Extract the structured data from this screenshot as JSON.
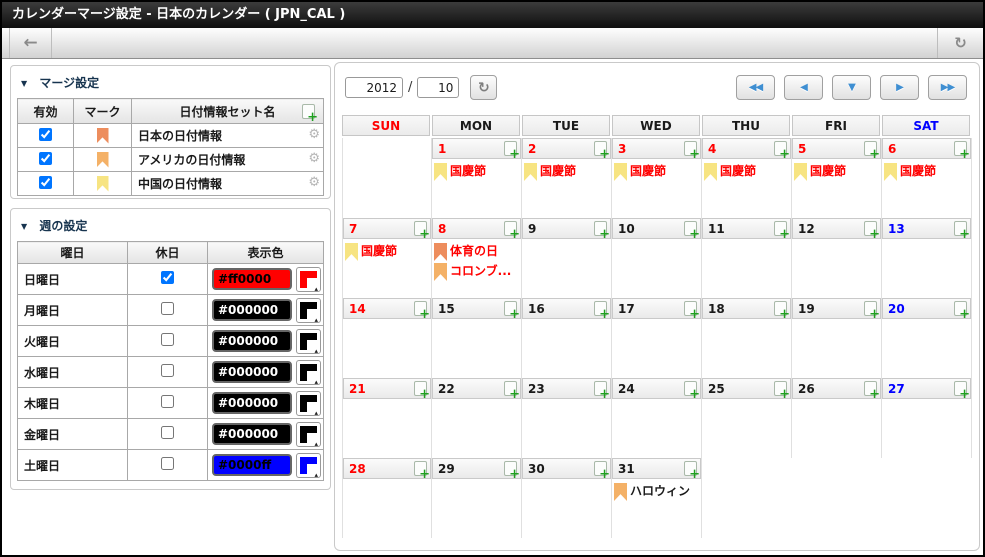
{
  "title_bar": {
    "title": "カレンダーマージ設定 - 日本のカレンダー ( JPN_CAL )"
  },
  "icons": {
    "back": "←",
    "refresh": "↻",
    "collapse": "▼",
    "plus": "+",
    "gear": "⚙",
    "nav_first": "◀◀",
    "nav_prev": "◀",
    "nav_today": "▼",
    "nav_next": "▶",
    "nav_last": "▶▶",
    "swatch_arrow": "▴"
  },
  "merge_panel": {
    "header": "マージ設定",
    "columns": {
      "enabled": "有効",
      "mark": "マーク",
      "name": "日付情報セット名"
    },
    "rows": [
      {
        "enabled": true,
        "mark_color": "#ed8d5d",
        "name": "日本の日付情報"
      },
      {
        "enabled": true,
        "mark_color": "#f4b167",
        "name": "アメリカの日付情報"
      },
      {
        "enabled": true,
        "mark_color": "#f7e482",
        "name": "中国の日付情報"
      }
    ]
  },
  "week_panel": {
    "header": "週の設定",
    "columns": {
      "day": "曜日",
      "holiday": "休日",
      "color": "表示色"
    },
    "rows": [
      {
        "day": "日曜日",
        "holiday": true,
        "color": "#ff0000",
        "text_color": "#000000"
      },
      {
        "day": "月曜日",
        "holiday": false,
        "color": "#000000",
        "text_color": "#ffffff"
      },
      {
        "day": "火曜日",
        "holiday": false,
        "color": "#000000",
        "text_color": "#ffffff"
      },
      {
        "day": "水曜日",
        "holiday": false,
        "color": "#000000",
        "text_color": "#ffffff"
      },
      {
        "day": "木曜日",
        "holiday": false,
        "color": "#000000",
        "text_color": "#ffffff"
      },
      {
        "day": "金曜日",
        "holiday": false,
        "color": "#000000",
        "text_color": "#ffffff"
      },
      {
        "day": "土曜日",
        "holiday": false,
        "color": "#0000ff",
        "text_color": "#000000"
      }
    ]
  },
  "calendar": {
    "year": "2012",
    "separator": "/",
    "month": "10",
    "day_headers": [
      {
        "label": "SUN",
        "color": "#ff0000"
      },
      {
        "label": "MON",
        "color": "#1a1a1a"
      },
      {
        "label": "TUE",
        "color": "#1a1a1a"
      },
      {
        "label": "WED",
        "color": "#1a1a1a"
      },
      {
        "label": "THU",
        "color": "#1a1a1a"
      },
      {
        "label": "FRI",
        "color": "#1a1a1a"
      },
      {
        "label": "SAT",
        "color": "#0000ff"
      }
    ],
    "mark_colors": {
      "japan": "#ed8d5d",
      "america": "#f4b167",
      "china": "#f7e482"
    },
    "weeks": [
      [
        {
          "date": null,
          "bordered": true
        },
        {
          "date": "1",
          "color": "#ff0000",
          "events": [
            {
              "set": "china",
              "label": "国慶節",
              "color": "#ff0000"
            }
          ]
        },
        {
          "date": "2",
          "color": "#ff0000",
          "events": [
            {
              "set": "china",
              "label": "国慶節",
              "color": "#ff0000"
            }
          ]
        },
        {
          "date": "3",
          "color": "#ff0000",
          "events": [
            {
              "set": "china",
              "label": "国慶節",
              "color": "#ff0000"
            }
          ]
        },
        {
          "date": "4",
          "color": "#ff0000",
          "events": [
            {
              "set": "china",
              "label": "国慶節",
              "color": "#ff0000"
            }
          ]
        },
        {
          "date": "5",
          "color": "#ff0000",
          "events": [
            {
              "set": "china",
              "label": "国慶節",
              "color": "#ff0000"
            }
          ]
        },
        {
          "date": "6",
          "color": "#ff0000",
          "events": [
            {
              "set": "china",
              "label": "国慶節",
              "color": "#ff0000"
            }
          ]
        }
      ],
      [
        {
          "date": "7",
          "color": "#ff0000",
          "events": [
            {
              "set": "china",
              "label": "国慶節",
              "color": "#ff0000"
            }
          ]
        },
        {
          "date": "8",
          "color": "#ff0000",
          "events": [
            {
              "set": "japan",
              "label": "体育の日",
              "color": "#ff0000"
            },
            {
              "set": "america",
              "label": "コロンブ...",
              "color": "#ff0000"
            }
          ]
        },
        {
          "date": "9",
          "color": "#1a1a1a"
        },
        {
          "date": "10",
          "color": "#1a1a1a"
        },
        {
          "date": "11",
          "color": "#1a1a1a"
        },
        {
          "date": "12",
          "color": "#1a1a1a"
        },
        {
          "date": "13",
          "color": "#0000ff"
        }
      ],
      [
        {
          "date": "14",
          "color": "#ff0000"
        },
        {
          "date": "15",
          "color": "#1a1a1a"
        },
        {
          "date": "16",
          "color": "#1a1a1a"
        },
        {
          "date": "17",
          "color": "#1a1a1a"
        },
        {
          "date": "18",
          "color": "#1a1a1a"
        },
        {
          "date": "19",
          "color": "#1a1a1a"
        },
        {
          "date": "20",
          "color": "#0000ff"
        }
      ],
      [
        {
          "date": "21",
          "color": "#ff0000"
        },
        {
          "date": "22",
          "color": "#1a1a1a"
        },
        {
          "date": "23",
          "color": "#1a1a1a"
        },
        {
          "date": "24",
          "color": "#1a1a1a"
        },
        {
          "date": "25",
          "color": "#1a1a1a"
        },
        {
          "date": "26",
          "color": "#1a1a1a"
        },
        {
          "date": "27",
          "color": "#0000ff"
        }
      ],
      [
        {
          "date": "28",
          "color": "#ff0000"
        },
        {
          "date": "29",
          "color": "#1a1a1a"
        },
        {
          "date": "30",
          "color": "#1a1a1a"
        },
        {
          "date": "31",
          "color": "#1a1a1a",
          "events": [
            {
              "set": "america",
              "label": "ハロウィン",
              "color": "#1a1a1a"
            }
          ]
        },
        {
          "date": null,
          "bordered": false
        },
        {
          "date": null,
          "bordered": false
        },
        {
          "date": null,
          "bordered": false
        }
      ]
    ]
  }
}
